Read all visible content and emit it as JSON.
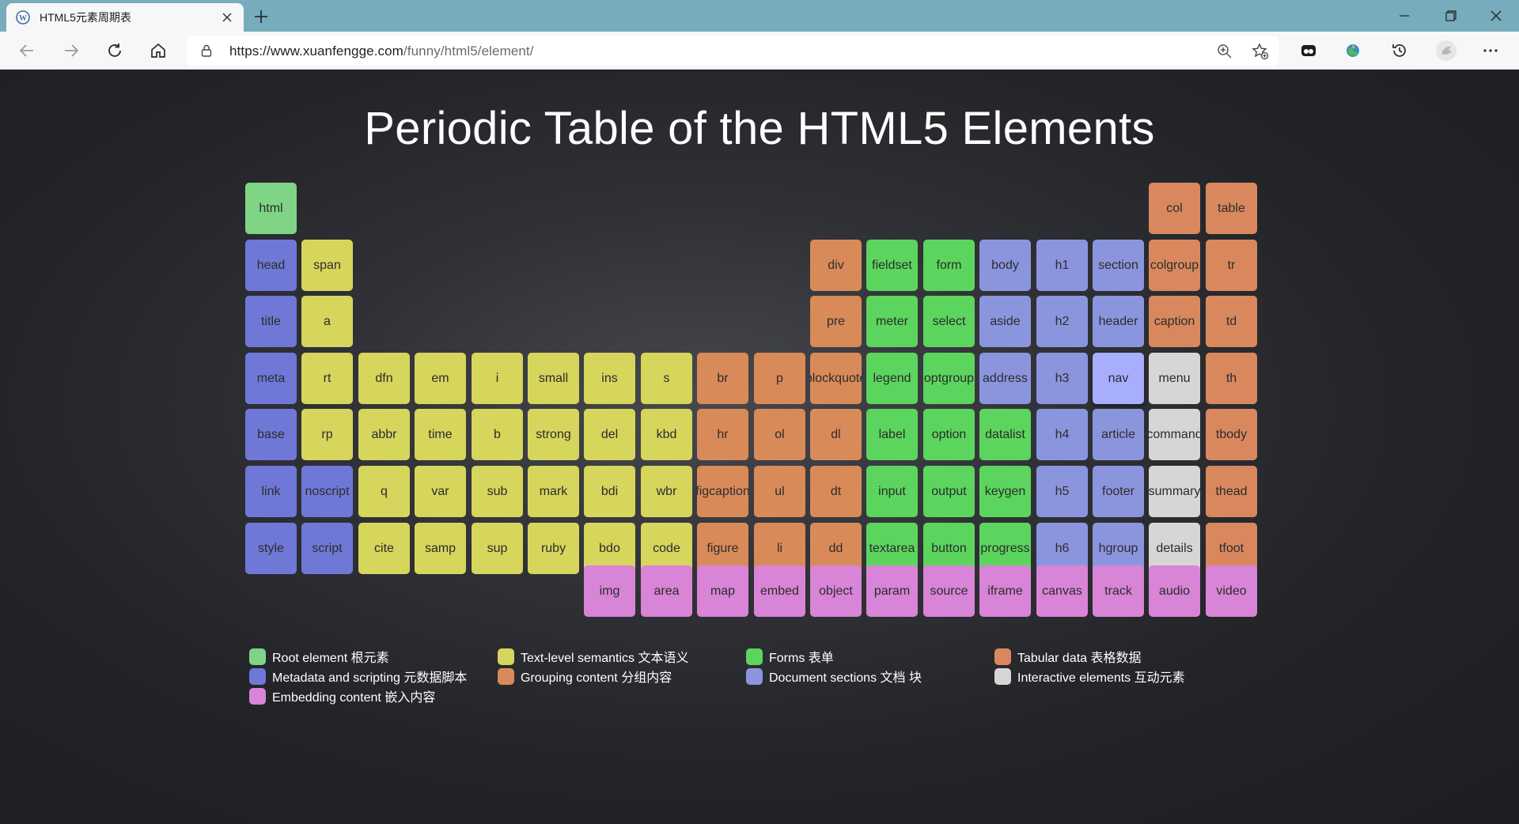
{
  "browser": {
    "tab_title": "HTML5元素周期表",
    "url_host": "https://www.xuanfengge.com",
    "url_path": "/funny/html5/element/"
  },
  "page": {
    "title": "Periodic Table of the HTML5 Elements"
  },
  "categories": {
    "root": {
      "label": "Root element 根元素",
      "color": "#7fd486"
    },
    "metadata": {
      "label": "Metadata and scripting 元数据脚本",
      "color": "#6f78d6"
    },
    "text": {
      "label": "Text-level semantics 文本语义",
      "color": "#d6d55c"
    },
    "grouping": {
      "label": "Grouping content 分组内容",
      "color": "#d98a59"
    },
    "forms": {
      "label": "Forms 表单",
      "color": "#5bd55e"
    },
    "sections": {
      "label": "Document sections 文档 块",
      "color": "#8b95de"
    },
    "tabular": {
      "label": "Tabular data 表格数据",
      "color": "#d9885e"
    },
    "interactive": {
      "label": "Interactive elements 互动元素",
      "color": "#d6d6d6"
    },
    "embedding": {
      "label": "Embedding content 嵌入内容",
      "color": "#d884d7"
    }
  },
  "elements": [
    {
      "name": "html",
      "cat": "root",
      "col": 0,
      "row": 0
    },
    {
      "name": "col",
      "cat": "tabular",
      "col": 16,
      "row": 0
    },
    {
      "name": "table",
      "cat": "tabular",
      "col": 17,
      "row": 0
    },
    {
      "name": "head",
      "cat": "metadata",
      "col": 0,
      "row": 1
    },
    {
      "name": "span",
      "cat": "text",
      "col": 1,
      "row": 1
    },
    {
      "name": "div",
      "cat": "grouping",
      "col": 10,
      "row": 1
    },
    {
      "name": "fieldset",
      "cat": "forms",
      "col": 11,
      "row": 1
    },
    {
      "name": "form",
      "cat": "forms",
      "col": 12,
      "row": 1
    },
    {
      "name": "body",
      "cat": "sections",
      "col": 13,
      "row": 1
    },
    {
      "name": "h1",
      "cat": "sections",
      "col": 14,
      "row": 1
    },
    {
      "name": "section",
      "cat": "sections",
      "col": 15,
      "row": 1
    },
    {
      "name": "colgroup",
      "cat": "tabular",
      "col": 16,
      "row": 1
    },
    {
      "name": "tr",
      "cat": "tabular",
      "col": 17,
      "row": 1
    },
    {
      "name": "title",
      "cat": "metadata",
      "col": 0,
      "row": 2
    },
    {
      "name": "a",
      "cat": "text",
      "col": 1,
      "row": 2
    },
    {
      "name": "pre",
      "cat": "grouping",
      "col": 10,
      "row": 2
    },
    {
      "name": "meter",
      "cat": "forms",
      "col": 11,
      "row": 2
    },
    {
      "name": "select",
      "cat": "forms",
      "col": 12,
      "row": 2
    },
    {
      "name": "aside",
      "cat": "sections",
      "col": 13,
      "row": 2
    },
    {
      "name": "h2",
      "cat": "sections",
      "col": 14,
      "row": 2
    },
    {
      "name": "header",
      "cat": "sections",
      "col": 15,
      "row": 2
    },
    {
      "name": "caption",
      "cat": "tabular",
      "col": 16,
      "row": 2
    },
    {
      "name": "td",
      "cat": "tabular",
      "col": 17,
      "row": 2
    },
    {
      "name": "meta",
      "cat": "metadata",
      "col": 0,
      "row": 3
    },
    {
      "name": "rt",
      "cat": "text",
      "col": 1,
      "row": 3
    },
    {
      "name": "dfn",
      "cat": "text",
      "col": 2,
      "row": 3
    },
    {
      "name": "em",
      "cat": "text",
      "col": 3,
      "row": 3
    },
    {
      "name": "i",
      "cat": "text",
      "col": 4,
      "row": 3
    },
    {
      "name": "small",
      "cat": "text",
      "col": 5,
      "row": 3
    },
    {
      "name": "ins",
      "cat": "text",
      "col": 6,
      "row": 3
    },
    {
      "name": "s",
      "cat": "text",
      "col": 7,
      "row": 3
    },
    {
      "name": "br",
      "cat": "grouping",
      "col": 8,
      "row": 3
    },
    {
      "name": "p",
      "cat": "grouping",
      "col": 9,
      "row": 3
    },
    {
      "name": "blockquote",
      "cat": "grouping",
      "col": 10,
      "row": 3
    },
    {
      "name": "legend",
      "cat": "forms",
      "col": 11,
      "row": 3
    },
    {
      "name": "optgroup",
      "cat": "forms",
      "col": 12,
      "row": 3
    },
    {
      "name": "address",
      "cat": "sections",
      "col": 13,
      "row": 3
    },
    {
      "name": "h3",
      "cat": "sections",
      "col": 14,
      "row": 3
    },
    {
      "name": "nav",
      "cat": "sections",
      "col": 15,
      "row": 3,
      "highlight": true
    },
    {
      "name": "menu",
      "cat": "interactive",
      "col": 16,
      "row": 3
    },
    {
      "name": "th",
      "cat": "tabular",
      "col": 17,
      "row": 3
    },
    {
      "name": "base",
      "cat": "metadata",
      "col": 0,
      "row": 4
    },
    {
      "name": "rp",
      "cat": "text",
      "col": 1,
      "row": 4
    },
    {
      "name": "abbr",
      "cat": "text",
      "col": 2,
      "row": 4
    },
    {
      "name": "time",
      "cat": "text",
      "col": 3,
      "row": 4
    },
    {
      "name": "b",
      "cat": "text",
      "col": 4,
      "row": 4
    },
    {
      "name": "strong",
      "cat": "text",
      "col": 5,
      "row": 4
    },
    {
      "name": "del",
      "cat": "text",
      "col": 6,
      "row": 4
    },
    {
      "name": "kbd",
      "cat": "text",
      "col": 7,
      "row": 4
    },
    {
      "name": "hr",
      "cat": "grouping",
      "col": 8,
      "row": 4
    },
    {
      "name": "ol",
      "cat": "grouping",
      "col": 9,
      "row": 4
    },
    {
      "name": "dl",
      "cat": "grouping",
      "col": 10,
      "row": 4
    },
    {
      "name": "label",
      "cat": "forms",
      "col": 11,
      "row": 4
    },
    {
      "name": "option",
      "cat": "forms",
      "col": 12,
      "row": 4
    },
    {
      "name": "datalist",
      "cat": "forms",
      "col": 13,
      "row": 4
    },
    {
      "name": "h4",
      "cat": "sections",
      "col": 14,
      "row": 4
    },
    {
      "name": "article",
      "cat": "sections",
      "col": 15,
      "row": 4
    },
    {
      "name": "command",
      "cat": "interactive",
      "col": 16,
      "row": 4
    },
    {
      "name": "tbody",
      "cat": "tabular",
      "col": 17,
      "row": 4
    },
    {
      "name": "link",
      "cat": "metadata",
      "col": 0,
      "row": 5
    },
    {
      "name": "noscript",
      "cat": "metadata",
      "col": 1,
      "row": 5
    },
    {
      "name": "q",
      "cat": "text",
      "col": 2,
      "row": 5
    },
    {
      "name": "var",
      "cat": "text",
      "col": 3,
      "row": 5
    },
    {
      "name": "sub",
      "cat": "text",
      "col": 4,
      "row": 5
    },
    {
      "name": "mark",
      "cat": "text",
      "col": 5,
      "row": 5
    },
    {
      "name": "bdi",
      "cat": "text",
      "col": 6,
      "row": 5
    },
    {
      "name": "wbr",
      "cat": "text",
      "col": 7,
      "row": 5
    },
    {
      "name": "figcaption",
      "cat": "grouping",
      "col": 8,
      "row": 5
    },
    {
      "name": "ul",
      "cat": "grouping",
      "col": 9,
      "row": 5
    },
    {
      "name": "dt",
      "cat": "grouping",
      "col": 10,
      "row": 5
    },
    {
      "name": "input",
      "cat": "forms",
      "col": 11,
      "row": 5
    },
    {
      "name": "output",
      "cat": "forms",
      "col": 12,
      "row": 5
    },
    {
      "name": "keygen",
      "cat": "forms",
      "col": 13,
      "row": 5
    },
    {
      "name": "h5",
      "cat": "sections",
      "col": 14,
      "row": 5
    },
    {
      "name": "footer",
      "cat": "sections",
      "col": 15,
      "row": 5
    },
    {
      "name": "summary",
      "cat": "interactive",
      "col": 16,
      "row": 5
    },
    {
      "name": "thead",
      "cat": "tabular",
      "col": 17,
      "row": 5
    },
    {
      "name": "style",
      "cat": "metadata",
      "col": 0,
      "row": 6
    },
    {
      "name": "script",
      "cat": "metadata",
      "col": 1,
      "row": 6
    },
    {
      "name": "cite",
      "cat": "text",
      "col": 2,
      "row": 6
    },
    {
      "name": "samp",
      "cat": "text",
      "col": 3,
      "row": 6
    },
    {
      "name": "sup",
      "cat": "text",
      "col": 4,
      "row": 6
    },
    {
      "name": "ruby",
      "cat": "text",
      "col": 5,
      "row": 6
    },
    {
      "name": "bdo",
      "cat": "text",
      "col": 6,
      "row": 6
    },
    {
      "name": "code",
      "cat": "text",
      "col": 7,
      "row": 6
    },
    {
      "name": "figure",
      "cat": "grouping",
      "col": 8,
      "row": 6
    },
    {
      "name": "li",
      "cat": "grouping",
      "col": 9,
      "row": 6
    },
    {
      "name": "dd",
      "cat": "grouping",
      "col": 10,
      "row": 6
    },
    {
      "name": "textarea",
      "cat": "forms",
      "col": 11,
      "row": 6
    },
    {
      "name": "button",
      "cat": "forms",
      "col": 12,
      "row": 6
    },
    {
      "name": "progress",
      "cat": "forms",
      "col": 13,
      "row": 6
    },
    {
      "name": "h6",
      "cat": "sections",
      "col": 14,
      "row": 6
    },
    {
      "name": "hgroup",
      "cat": "sections",
      "col": 15,
      "row": 6
    },
    {
      "name": "details",
      "cat": "interactive",
      "col": 16,
      "row": 6
    },
    {
      "name": "tfoot",
      "cat": "tabular",
      "col": 17,
      "row": 6
    },
    {
      "name": "img",
      "cat": "embedding",
      "col": 6,
      "row": 8
    },
    {
      "name": "area",
      "cat": "embedding",
      "col": 7,
      "row": 8
    },
    {
      "name": "map",
      "cat": "embedding",
      "col": 8,
      "row": 8
    },
    {
      "name": "embed",
      "cat": "embedding",
      "col": 9,
      "row": 8
    },
    {
      "name": "object",
      "cat": "embedding",
      "col": 10,
      "row": 8
    },
    {
      "name": "param",
      "cat": "embedding",
      "col": 11,
      "row": 8
    },
    {
      "name": "source",
      "cat": "embedding",
      "col": 12,
      "row": 8
    },
    {
      "name": "iframe",
      "cat": "embedding",
      "col": 13,
      "row": 8
    },
    {
      "name": "canvas",
      "cat": "embedding",
      "col": 14,
      "row": 8
    },
    {
      "name": "track",
      "cat": "embedding",
      "col": 15,
      "row": 8
    },
    {
      "name": "audio",
      "cat": "embedding",
      "col": 16,
      "row": 8
    },
    {
      "name": "video",
      "cat": "embedding",
      "col": 17,
      "row": 8
    }
  ],
  "legend": [
    {
      "cat": "root",
      "col": 0,
      "row": 0
    },
    {
      "cat": "text",
      "col": 1,
      "row": 0
    },
    {
      "cat": "forms",
      "col": 2,
      "row": 0
    },
    {
      "cat": "tabular",
      "col": 3,
      "row": 0
    },
    {
      "cat": "metadata",
      "col": 0,
      "row": 1
    },
    {
      "cat": "grouping",
      "col": 1,
      "row": 1
    },
    {
      "cat": "sections",
      "col": 2,
      "row": 1
    },
    {
      "cat": "interactive",
      "col": 3,
      "row": 1
    },
    {
      "cat": "embedding",
      "col": 0,
      "row": 2
    }
  ]
}
